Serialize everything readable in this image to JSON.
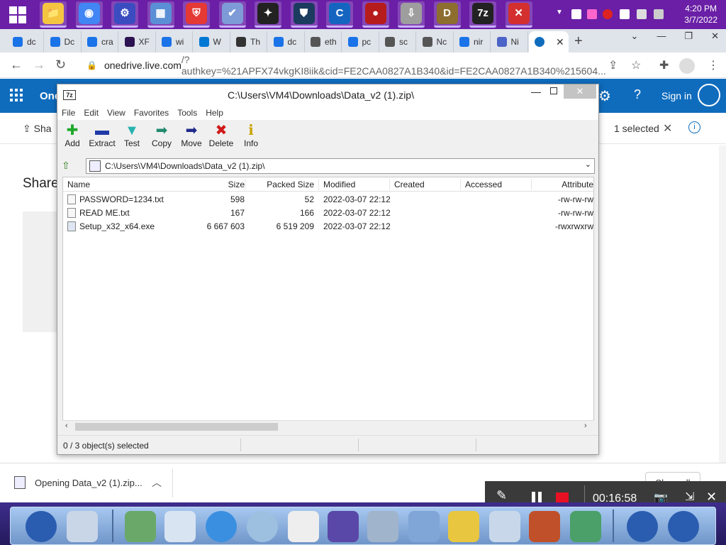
{
  "taskbar": {
    "pinned": [
      {
        "name": "folder-icon",
        "color": "#f5c542",
        "glyph": "📁",
        "active": true
      },
      {
        "name": "chrome-icon",
        "color": "#4285f4",
        "glyph": "◉",
        "active": true
      },
      {
        "name": "settings-icon",
        "color": "#3b4cc0",
        "glyph": "⚙",
        "active": true
      },
      {
        "name": "control-panel-icon",
        "color": "#5a8fd6",
        "glyph": "▦",
        "active": true
      },
      {
        "name": "shield-icon",
        "color": "#e53935",
        "glyph": "⛨",
        "active": true
      },
      {
        "name": "security-shield-icon",
        "color": "#7e9bd8",
        "glyph": "✔",
        "active": true
      },
      {
        "name": "antivirus-icon",
        "color": "#222222",
        "glyph": "✦",
        "active": true
      },
      {
        "name": "vpn-icon",
        "color": "#1b3b5f",
        "glyph": "⛊",
        "active": true
      },
      {
        "name": "ccleaner-icon",
        "color": "#1565c0",
        "glyph": "C",
        "active": true
      },
      {
        "name": "recorder-icon",
        "color": "#b71c1c",
        "glyph": "●",
        "active": true
      },
      {
        "name": "install-icon",
        "color": "#9e9e9e",
        "glyph": "⇩",
        "active": true
      },
      {
        "name": "dosbox-icon",
        "color": "#8d6e2f",
        "glyph": "D",
        "active": true
      },
      {
        "name": "sevenzip-icon",
        "color": "#222222",
        "glyph": "7z",
        "active": true
      },
      {
        "name": "close-app-icon",
        "color": "#d32f2f",
        "glyph": "✕",
        "active": true
      }
    ],
    "clock_time": "4:20 PM",
    "clock_date": "3/7/2022"
  },
  "browser": {
    "tabs": [
      {
        "label": "dc",
        "color": "#1a73e8"
      },
      {
        "label": "Dc",
        "color": "#1a73e8"
      },
      {
        "label": "cra",
        "color": "#1a73e8"
      },
      {
        "label": "XF",
        "color": "#2b1250"
      },
      {
        "label": "wi",
        "color": "#1a73e8"
      },
      {
        "label": "W",
        "color": "#0078d4"
      },
      {
        "label": "Th",
        "color": "#333333"
      },
      {
        "label": "dc",
        "color": "#1a73e8"
      },
      {
        "label": "eth",
        "color": "#555555"
      },
      {
        "label": "pc",
        "color": "#1a73e8"
      },
      {
        "label": "sc",
        "color": "#555555"
      },
      {
        "label": "Nc",
        "color": "#555555"
      },
      {
        "label": "nir",
        "color": "#1a73e8"
      },
      {
        "label": "Ni",
        "color": "#4a64c8"
      }
    ],
    "url_host": "onedrive.live.com",
    "url_rest": "/?authkey=%21APFX74vkgKI8iik&cid=FE2CAA0827A1B340&id=FE2CAA0827A1B340%215604..."
  },
  "onedrive": {
    "title": "One",
    "signin": "Sign in",
    "share": "Sha",
    "selected": "1 selected",
    "heading": "Share"
  },
  "download": {
    "label": "Opening Data_v2 (1).zip...",
    "show_all": "Show all"
  },
  "recorder": {
    "time": "00:16:58"
  },
  "sevenzip": {
    "title": "C:\\Users\\VM4\\Downloads\\Data_v2 (1).zip\\",
    "menus": [
      "File",
      "Edit",
      "View",
      "Favorites",
      "Tools",
      "Help"
    ],
    "tools": [
      {
        "label": "Add",
        "glyph": "✚",
        "color": "#1fa82b",
        "name": "add-icon"
      },
      {
        "label": "Extract",
        "glyph": "▬",
        "color": "#1f3aa8",
        "name": "extract-icon"
      },
      {
        "label": "Test",
        "glyph": "▼",
        "color": "#26b3b0",
        "name": "test-icon"
      },
      {
        "label": "Copy",
        "glyph": "➡",
        "color": "#1f8a6e",
        "name": "copy-icon"
      },
      {
        "label": "Move",
        "glyph": "➡",
        "color": "#1f2a8a",
        "name": "move-icon"
      },
      {
        "label": "Delete",
        "glyph": "✖",
        "color": "#d01a1a",
        "name": "delete-icon"
      },
      {
        "label": "Info",
        "glyph": "ℹ",
        "color": "#c9a400",
        "name": "info-icon"
      }
    ],
    "path": "C:\\Users\\VM4\\Downloads\\Data_v2 (1).zip\\",
    "columns": {
      "name": "Name",
      "size": "Size",
      "packed": "Packed Size",
      "modified": "Modified",
      "created": "Created",
      "accessed": "Accessed",
      "attributes": "Attribute"
    },
    "files": [
      {
        "name": "PASSWORD=1234.txt",
        "size": "598",
        "packed": "52",
        "modified": "2022-03-07 22:12",
        "attributes": "-rw-rw-rw",
        "kind": "txt"
      },
      {
        "name": "READ ME.txt",
        "size": "167",
        "packed": "166",
        "modified": "2022-03-07 22:12",
        "attributes": "-rw-rw-rw",
        "kind": "txt"
      },
      {
        "name": "Setup_x32_x64.exe",
        "size": "6 667 603",
        "packed": "6 519 209",
        "modified": "2022-03-07 22:12",
        "attributes": "-rwxrwxrw",
        "kind": "exe"
      }
    ],
    "status": "0 / 3 object(s) selected"
  }
}
